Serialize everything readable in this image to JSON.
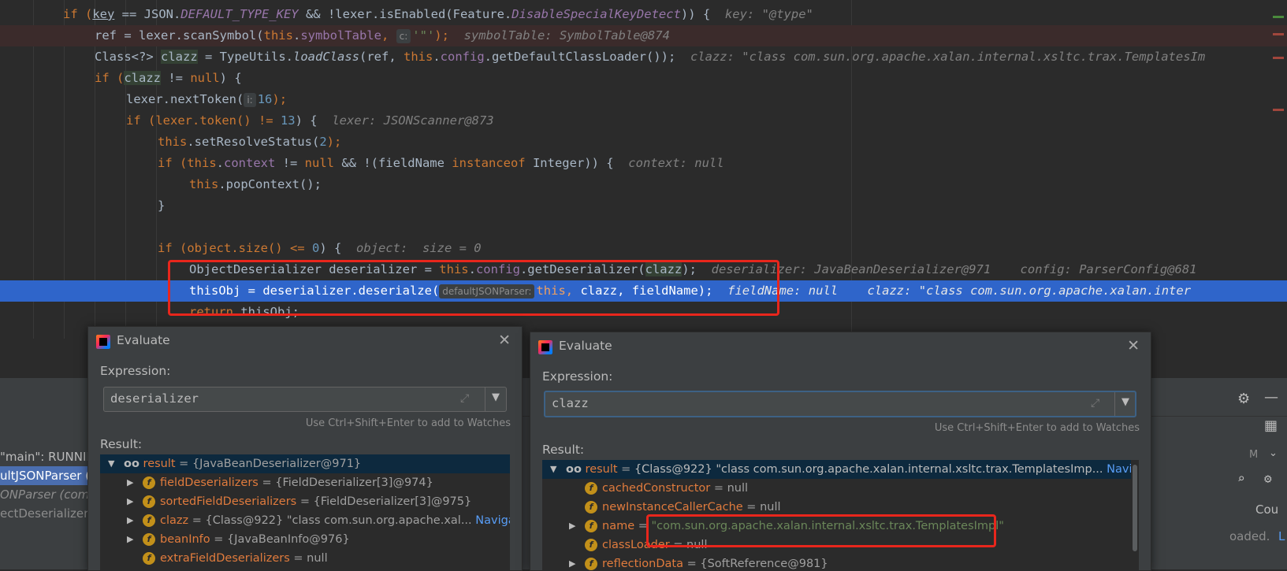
{
  "code": {
    "l1": {
      "a": "if (",
      "b": "key",
      "c": " == JSON.",
      "d": "DEFAULT_TYPE_KEY",
      "e": " && !lexer.isEnabled(Feature.",
      "f": "DisableSpecialKeyDetect",
      "g": ")) {",
      "h": "key: \"@type\""
    },
    "l2": {
      "a": "ref = lexer.scanSymbol(",
      "b": "this",
      "c": ".",
      "d": "symbolTable",
      "e": ", ",
      "hint": "c:",
      "f": "'\"'",
      "g": ");",
      "h": "symbolTable: SymbolTable@874"
    },
    "l3": {
      "a": "Class<?> ",
      "b": "clazz",
      "c": " = TypeUtils.",
      "d": "loadClass",
      "e": "(ref, ",
      "f": "this",
      "g": ".",
      "h": "config",
      "i": ".getDefaultClassLoader());",
      "j": "clazz: \"class com.sun.org.apache.xalan.internal.xsltc.trax.TemplatesIm"
    },
    "l4": {
      "a": "if (",
      "b": "clazz",
      "c": " != ",
      "d": "null",
      "e": ") {"
    },
    "l5": {
      "a": "lexer.nextToken(",
      "hint": "i:",
      "b": "16",
      "c": ");"
    },
    "l6": {
      "a": "if (lexer.token() != ",
      "b": "13",
      "c": ") {",
      "d": "lexer: JSONScanner@873"
    },
    "l7": {
      "a": "this",
      "b": ".setResolveStatus(",
      "c": "2",
      "d": ");"
    },
    "l8": {
      "a": "if (",
      "b": "this",
      "c": ".",
      "d": "context",
      "e": " != ",
      "f": "null",
      "g": " && !(fieldName ",
      "h": "instanceof",
      "i": " Integer)) {",
      "j": "context: null"
    },
    "l9": {
      "a": "this",
      "b": ".popContext();"
    },
    "l10": {
      "a": "}"
    },
    "l12": {
      "a": "if (object.size() <= ",
      "b": "0",
      "c": ") {",
      "d": "object:  size = 0"
    },
    "l13": {
      "a": "ObjectDeserializer deserializer = ",
      "b": "this",
      "c": ".",
      "d": "config",
      "e": ".getDeserializer(",
      "f": "clazz",
      "g": ");",
      "h": "deserializer: JavaBeanDeserializer@971",
      "i": "config: ParserConfig@681"
    },
    "l14": {
      "a": "thisObj = deserializer.deserialze(",
      "hint": "defaultJSONParser:",
      "b": "this",
      "c": ", ",
      "d": "clazz",
      "e": ", fieldName);",
      "f": "fieldName: null",
      "g": "clazz: \"class com.sun.org.apache.xalan.inter"
    },
    "l15": {
      "a": "return",
      "b": " thisObj;"
    }
  },
  "debugger": {
    "frames": [
      "\"main\": RUNNIN",
      "ultJSONParser (",
      "ONParser (com.a",
      "ectDeserializer"
    ],
    "right_labels": {
      "m": "M",
      "cou": "Cou",
      "loaded": "oaded.",
      "l": "L"
    }
  },
  "eval1": {
    "title": "Evaluate",
    "expression_label": "Expression:",
    "expression": "deserializer",
    "watch_hint": "Use Ctrl+Shift+Enter to add to Watches",
    "result_label": "Result:",
    "rows": [
      {
        "name": "result",
        "eq": " = ",
        "val": "{JavaBeanDeserializer@971}"
      },
      {
        "name": "fieldDeserializers",
        "eq": " = ",
        "val": "{FieldDeserializer[3]@974}"
      },
      {
        "name": "sortedFieldDeserializers",
        "eq": " = ",
        "val": "{FieldDeserializer[3]@975}"
      },
      {
        "name": "clazz",
        "eq": " = ",
        "val": "{Class@922} \"class com.sun.org.apache.xal... ",
        "nav": "Navigate"
      },
      {
        "name": "beanInfo",
        "eq": " = ",
        "val": "{JavaBeanInfo@976}"
      },
      {
        "name": "extraFieldDeserializers",
        "eq": " = ",
        "val": "null"
      }
    ]
  },
  "eval2": {
    "title": "Evaluate",
    "expression_label": "Expression:",
    "expression": "clazz",
    "watch_hint": "Use Ctrl+Shift+Enter to add to Watches",
    "result_label": "Result:",
    "rows": [
      {
        "name": "result",
        "eq": " = ",
        "val": "{Class@922} \"class com.sun.org.apache.xalan.internal.xsltc.trax.TemplatesImp... ",
        "nav": "Navigate"
      },
      {
        "name": "cachedConstructor",
        "eq": " = ",
        "val": "null"
      },
      {
        "name": "newInstanceCallerCache",
        "eq": " = ",
        "val": "null"
      },
      {
        "name": "name",
        "eq": " = ",
        "val": "\"com.sun.org.apache.xalan.internal.xsltc.trax.TemplatesImpl\""
      },
      {
        "name": "classLoader",
        "eq": " = ",
        "val": "null"
      },
      {
        "name": "reflectionData",
        "eq": " = ",
        "val": "{SoftReference@981}"
      }
    ]
  }
}
